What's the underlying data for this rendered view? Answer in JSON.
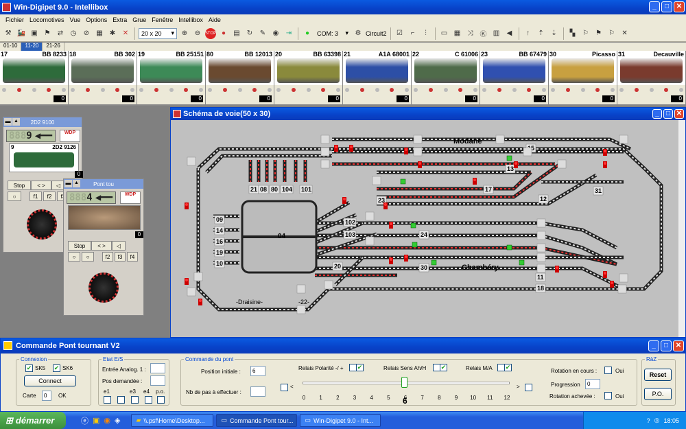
{
  "app": {
    "title": "Win-Digipet 9.0 -  Intellibox"
  },
  "menu": [
    "Fichier",
    "Locomotives",
    "Vue",
    "Options",
    "Extra",
    "Grue",
    "Fenêtre",
    "Intellibox",
    "Aide"
  ],
  "toolbar": {
    "grid": "20 x 20",
    "com": "COM: 3",
    "circuit": "Circuit2"
  },
  "loco_tabs": [
    "01-10",
    "11-20",
    "21-26"
  ],
  "locos": [
    {
      "num": "17",
      "name": "BB 8233",
      "color": "#2e6b3b"
    },
    {
      "num": "18",
      "name": "BB 302",
      "color": "#5b6e58"
    },
    {
      "num": "19",
      "name": "BB 25151",
      "color": "#3d8a57"
    },
    {
      "num": "80",
      "name": "BB 12013",
      "color": "#6a4a30"
    },
    {
      "num": "20",
      "name": "BB 63398",
      "color": "#8a8a3c"
    },
    {
      "num": "21",
      "name": "A1A 68001",
      "color": "#2d4fa6"
    },
    {
      "num": "22",
      "name": "C 61006",
      "color": "#4f6b4a"
    },
    {
      "num": "23",
      "name": "BB 67479",
      "color": "#3050b0"
    },
    {
      "num": "30",
      "name": "Picasso",
      "color": "#c8a040"
    },
    {
      "num": "31",
      "name": "Decauville",
      "color": "#7a3b2e"
    }
  ],
  "loco_speeds": [
    "0",
    "0",
    "0",
    "0",
    "0",
    "0",
    "0",
    "0",
    "0",
    "0"
  ],
  "panel1": {
    "head": "2D2 9100",
    "lcd": "9",
    "num": "9",
    "name": "2D2 9126",
    "stop": "Stop",
    "dir": "< >",
    "f1": "f1",
    "f2": "f2",
    "f3": "f3",
    "speed": "0"
  },
  "panel2": {
    "head": "Pont tou",
    "lcd": "4",
    "stop": "Stop",
    "dir": "< >",
    "f1": "f1",
    "f2": "f2",
    "f3": "f3",
    "f4": "f4",
    "speed": "0"
  },
  "schema": {
    "title": "Schéma de voie(50 x 30)",
    "station1": "Modane",
    "station2": "Chambéry",
    "draisine": "-Draisine-",
    "n22": "-22-",
    "turntable_pos": "04"
  },
  "track_labels": [
    "15",
    "13",
    "17",
    "12",
    "23",
    "31",
    "24",
    "30",
    "11",
    "18",
    "09",
    "14",
    "16",
    "19",
    "10",
    "20",
    "102",
    "103",
    "21",
    "08",
    "80",
    "104",
    "101"
  ],
  "dialog": {
    "title": "Commande Pont tournant V2",
    "connexion": {
      "legend": "Connexion",
      "sk5": "SK5",
      "sk6": "SK6",
      "connect": "Connect",
      "carte_label": "Carte",
      "carte_value": "0",
      "ok": "OK"
    },
    "etat": {
      "legend": "Etat E/S",
      "entree": "Entrée Analog. 1 :",
      "pos": "Pos demandée :",
      "e1": "e1",
      "e3": "e3",
      "e4": "e4",
      "po": "p.o."
    },
    "cmd": {
      "legend": "Commande du pont",
      "pos_init_label": "Position initiale :",
      "pos_init": "6",
      "nb_pas_label": "Nb de pas à effectuer :",
      "relais_pol": "Relais Polarité -/ +",
      "relais_sens": "Relais Sens Ah/H",
      "relais_ma": "Relais M/A",
      "slider_value": "6",
      "slider_fraction": 0.5,
      "ticks": [
        "0",
        "1",
        "2",
        "3",
        "4",
        "5",
        "6",
        "7",
        "8",
        "9",
        "10",
        "11",
        "12"
      ]
    },
    "rot": {
      "en_cours": "Rotation en cours :",
      "oui1": "Oui",
      "progression": "Progression",
      "prog_value": "0",
      "achevee": "Rotation achevée :",
      "oui2": "Oui"
    },
    "raz": {
      "legend": "RàZ",
      "reset": "Reset",
      "po": "P.O."
    }
  },
  "taskbar": {
    "start": "démarrer",
    "tasks": [
      "\\\\.psf\\Home\\Desktop...",
      "Commande Pont tour...",
      "Win-Digipet 9.0 - Int..."
    ],
    "clock": "18:05"
  }
}
